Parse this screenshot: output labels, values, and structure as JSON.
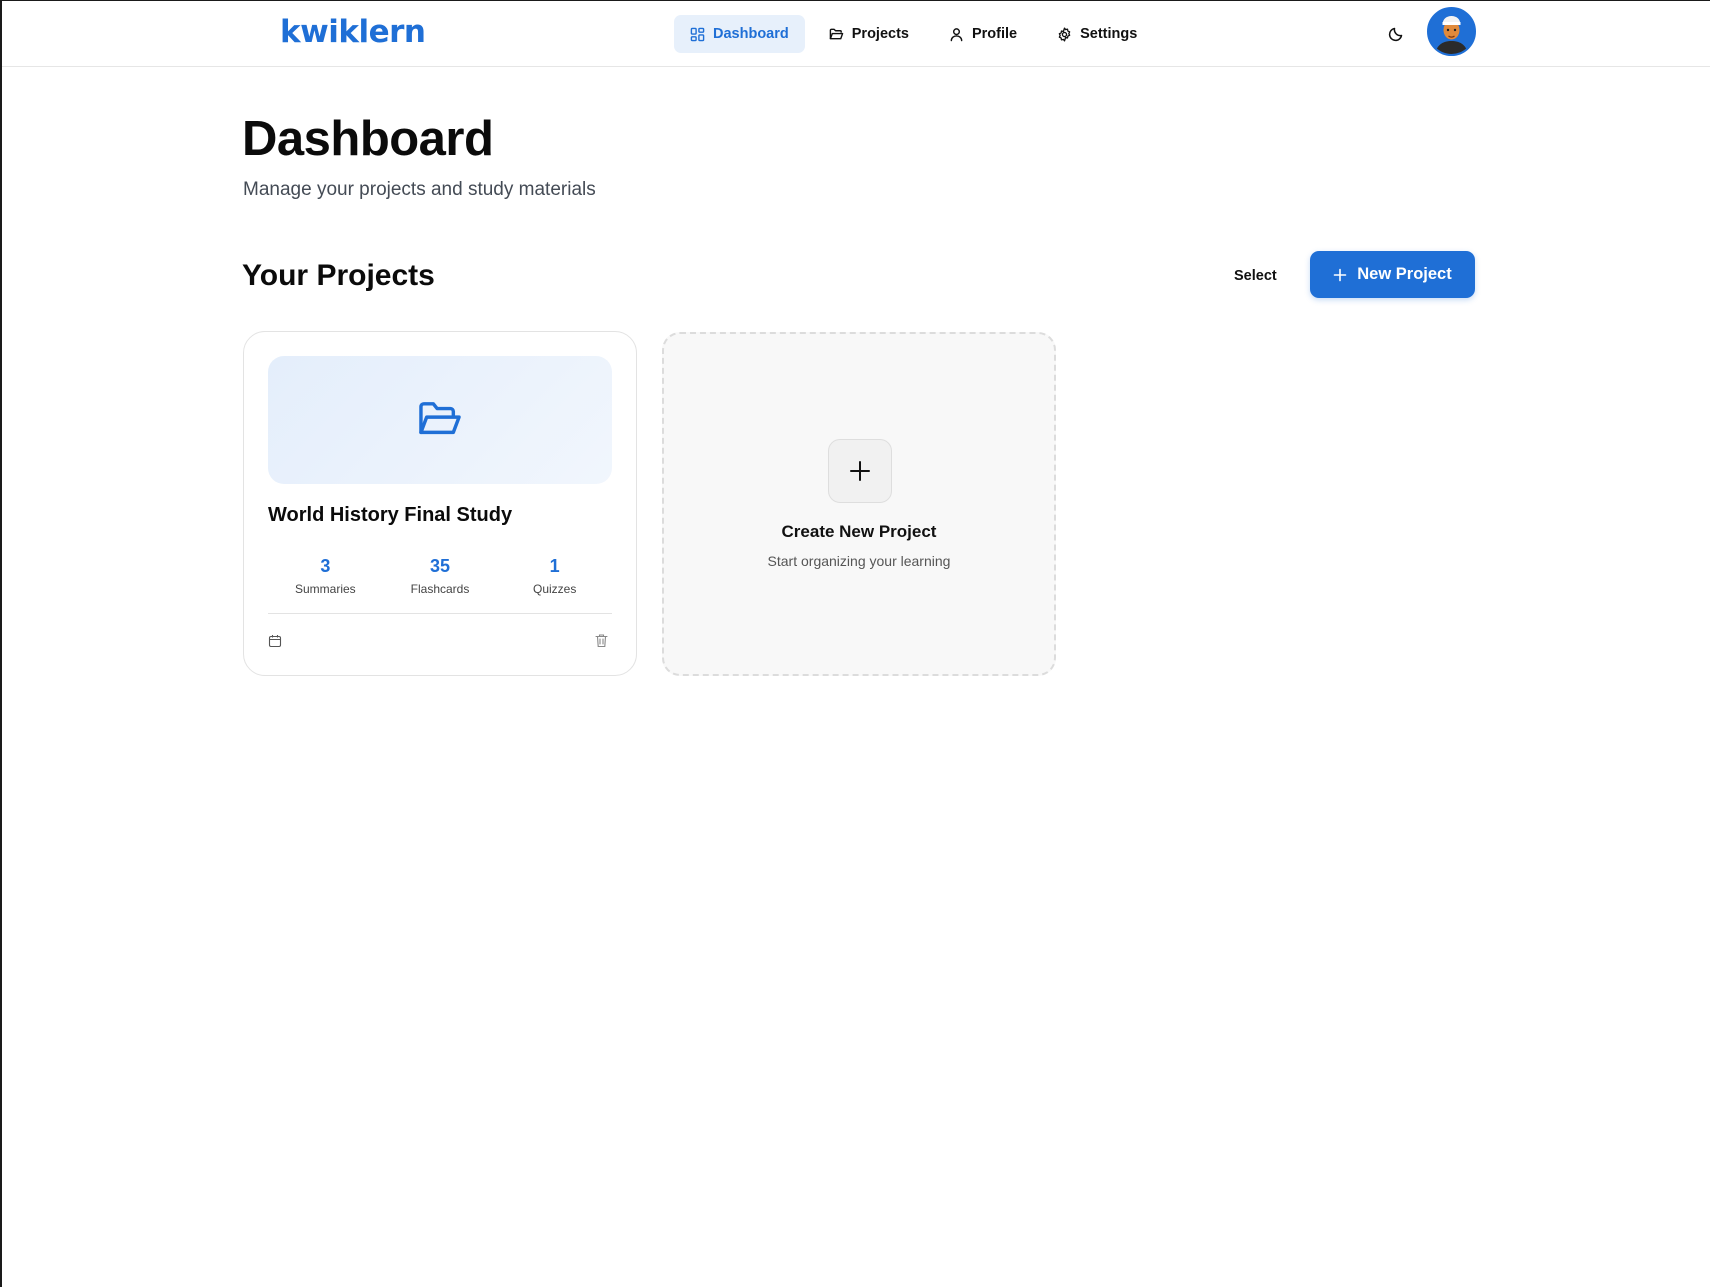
{
  "header": {
    "logo": "kwiklern",
    "nav": [
      {
        "label": "Dashboard",
        "icon": "grid-icon",
        "active": true
      },
      {
        "label": "Projects",
        "icon": "folder-icon",
        "active": false
      },
      {
        "label": "Profile",
        "icon": "user-icon",
        "active": false
      },
      {
        "label": "Settings",
        "icon": "gear-icon",
        "active": false
      }
    ],
    "theme_toggle_icon": "moon-icon",
    "avatar_icon": "avatar-icon"
  },
  "page": {
    "title": "Dashboard",
    "subtitle": "Manage your projects and study materials"
  },
  "projects_section": {
    "title": "Your Projects",
    "select_label": "Select",
    "new_project_label": "New Project"
  },
  "projects": [
    {
      "title": "World History Final Study",
      "stats": [
        {
          "value": "3",
          "label": "Summaries"
        },
        {
          "value": "35",
          "label": "Flashcards"
        },
        {
          "value": "1",
          "label": "Quizzes"
        }
      ]
    }
  ],
  "create_card": {
    "title": "Create New Project",
    "subtitle": "Start organizing your learning"
  },
  "colors": {
    "accent": "#1f6fd6",
    "active_nav_bg": "#e7f0fb"
  }
}
